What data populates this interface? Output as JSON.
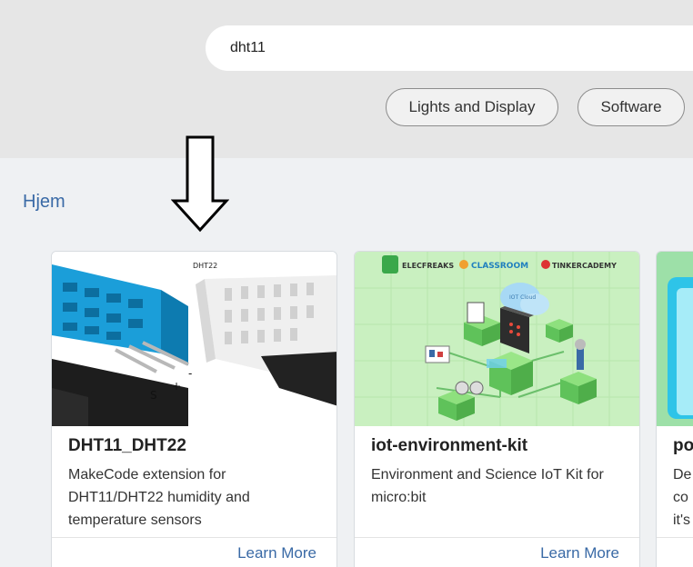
{
  "search": {
    "value": "dht11"
  },
  "categories": [
    "Lights and Display",
    "Software"
  ],
  "breadcrumb": "Hjem",
  "cards": [
    {
      "title": "DHT11_DHT22",
      "description": "MakeCode extension for DHT11/DHT22 humidity and temperature sensors",
      "link": "Learn More",
      "thumb_text": "DHT22"
    },
    {
      "title": "iot-environment-kit",
      "description": "Environment and Science IoT Kit for micro:bit",
      "link": "Learn More",
      "logos": [
        "ELECFREAKS",
        "CLASSROOM",
        "TINKERCADEMY"
      ],
      "thumb_text": "IOT Cloud"
    },
    {
      "title": "po",
      "description": "De co it's",
      "link": ""
    }
  ],
  "colors": {
    "accent": "#3a6aa6",
    "header_bg": "#e6e6e6",
    "page_bg": "#eff1f3"
  }
}
